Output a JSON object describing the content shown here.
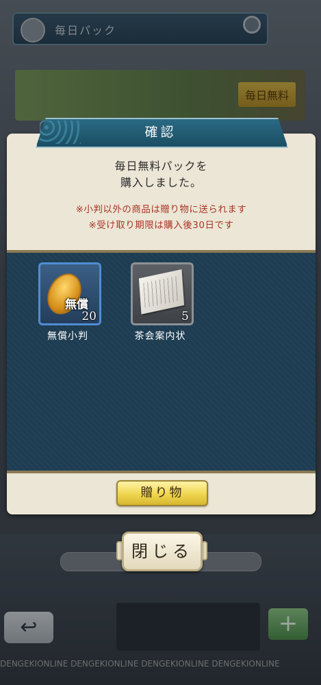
{
  "background": {
    "header_title": "毎日パック",
    "banner_tag": "毎日無料",
    "watermark": "DENGEKIONLINE DENGEKIONLINE DENGEKIONLINE DENGEKIONLINE"
  },
  "dialog": {
    "title": "確認",
    "message_line1": "毎日無料パックを",
    "message_line2": "購入しました。",
    "note_line1": "※小判以外の商品は贈り物に送られます",
    "note_line2": "※受け取り期限は購入後30日です",
    "items": [
      {
        "name": "無償小判",
        "icon": "koban-coin-icon",
        "badge": "無償",
        "quantity": "20"
      },
      {
        "name": "茶会案内状",
        "icon": "invitation-letter-icon",
        "quantity": "5"
      }
    ],
    "gift_button": "贈り物"
  },
  "close_button": "閉じる",
  "colors": {
    "dialog_bg": "#ece6d6",
    "items_panel": "#1e3d52",
    "note_red": "#a83626",
    "title_tab": "#1b4e63",
    "gift_button": "#efd64e"
  }
}
